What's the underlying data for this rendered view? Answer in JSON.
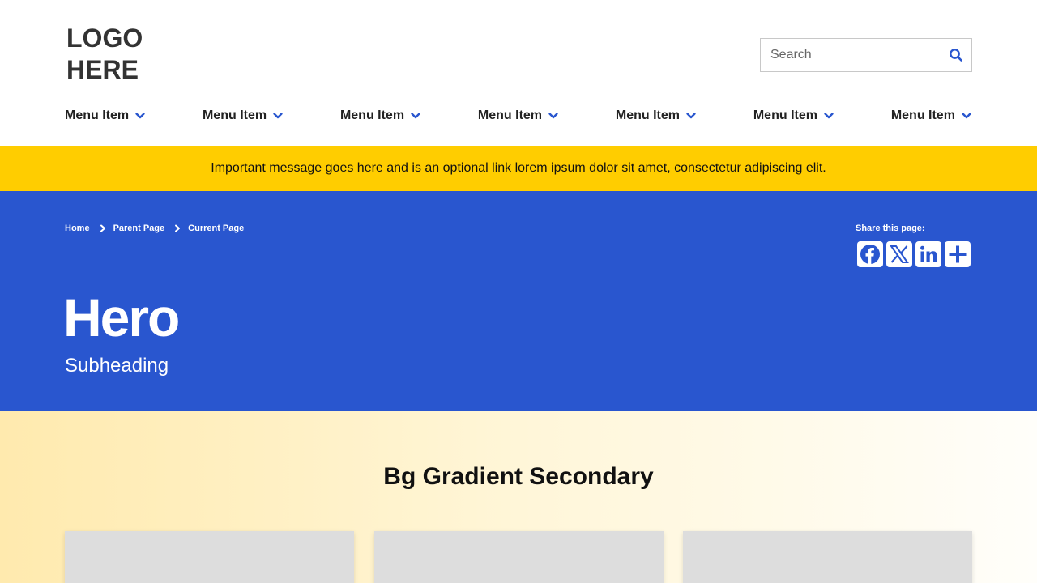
{
  "header": {
    "logo": "LOGO HERE",
    "search": {
      "placeholder": "Search",
      "icon": "search-icon"
    },
    "nav": [
      {
        "label": "Menu Item",
        "icon": "chevron-down-icon"
      },
      {
        "label": "Menu Item",
        "icon": "chevron-down-icon"
      },
      {
        "label": "Menu Item",
        "icon": "chevron-down-icon"
      },
      {
        "label": "Menu Item",
        "icon": "chevron-down-icon"
      },
      {
        "label": "Menu Item",
        "icon": "chevron-down-icon"
      },
      {
        "label": "Menu Item",
        "icon": "chevron-down-icon"
      },
      {
        "label": "Menu Item",
        "icon": "chevron-down-icon"
      }
    ]
  },
  "alert": {
    "message": "Important message goes here and is an optional link lorem ipsum dolor sit amet, consectetur adipiscing elit."
  },
  "hero": {
    "breadcrumb": [
      {
        "label": "Home"
      },
      {
        "label": "Parent Page"
      },
      {
        "label": "Current Page"
      }
    ],
    "share": {
      "label": "Share this page:",
      "icons": [
        "facebook-icon",
        "x-icon",
        "linkedin-icon",
        "plus-icon"
      ]
    },
    "title": "Hero",
    "subtitle": "Subheading"
  },
  "section": {
    "title": "Bg Gradient Secondary"
  },
  "colors": {
    "primary": "#2956cf",
    "alert": "#ffcd00",
    "gradient_start": "#ffeaae",
    "gradient_end": "#fffefa",
    "card": "#dddddd"
  }
}
